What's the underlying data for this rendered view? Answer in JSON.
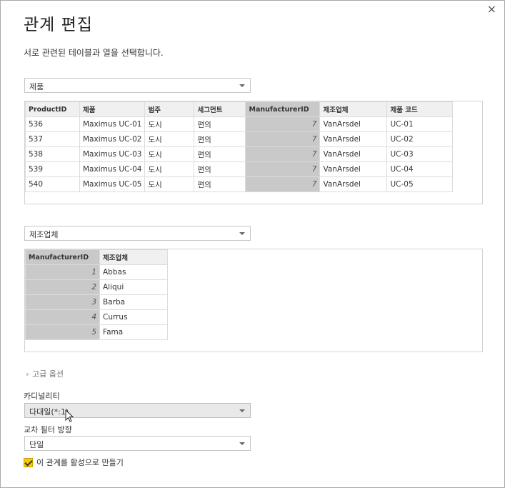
{
  "dialog": {
    "title": "관계 편집",
    "subtitle": "서로 관련된 테이블과 열을 선택합니다.",
    "close_glyph": "×"
  },
  "table1": {
    "selected": "제품",
    "columns": [
      "ProductID",
      "제품",
      "범주",
      "세그먼트",
      "ManufacturerID",
      "제조업체",
      "제품 코드"
    ],
    "rows": [
      [
        "536",
        "Maximus UC-01",
        "도시",
        "편의",
        "7",
        "VanArsdel",
        "UC-01"
      ],
      [
        "537",
        "Maximus UC-02",
        "도시",
        "편의",
        "7",
        "VanArsdel",
        "UC-02"
      ],
      [
        "538",
        "Maximus UC-03",
        "도시",
        "편의",
        "7",
        "VanArsdel",
        "UC-03"
      ],
      [
        "539",
        "Maximus UC-04",
        "도시",
        "편의",
        "7",
        "VanArsdel",
        "UC-04"
      ],
      [
        "540",
        "Maximus UC-05",
        "도시",
        "편의",
        "7",
        "VanArsdel",
        "UC-05"
      ]
    ]
  },
  "table2": {
    "selected": "제조업체",
    "columns": [
      "ManufacturerID",
      "제조업체"
    ],
    "rows": [
      [
        "1",
        "Abbas"
      ],
      [
        "2",
        "Aliqui"
      ],
      [
        "3",
        "Barba"
      ],
      [
        "4",
        "Currus"
      ],
      [
        "5",
        "Fama"
      ]
    ]
  },
  "advanced": {
    "label": "고급 옵션"
  },
  "cardinality": {
    "label": "카디널리티",
    "value": "다대일(*:1)"
  },
  "filter": {
    "label": "교차 필터 방향",
    "value": "단일"
  },
  "active": {
    "label": "이 관계를 활성으로 만들기",
    "checked": true
  },
  "colors": {
    "accent_checkbox": "#f2c811",
    "selected_column": "#c9c9c9"
  }
}
